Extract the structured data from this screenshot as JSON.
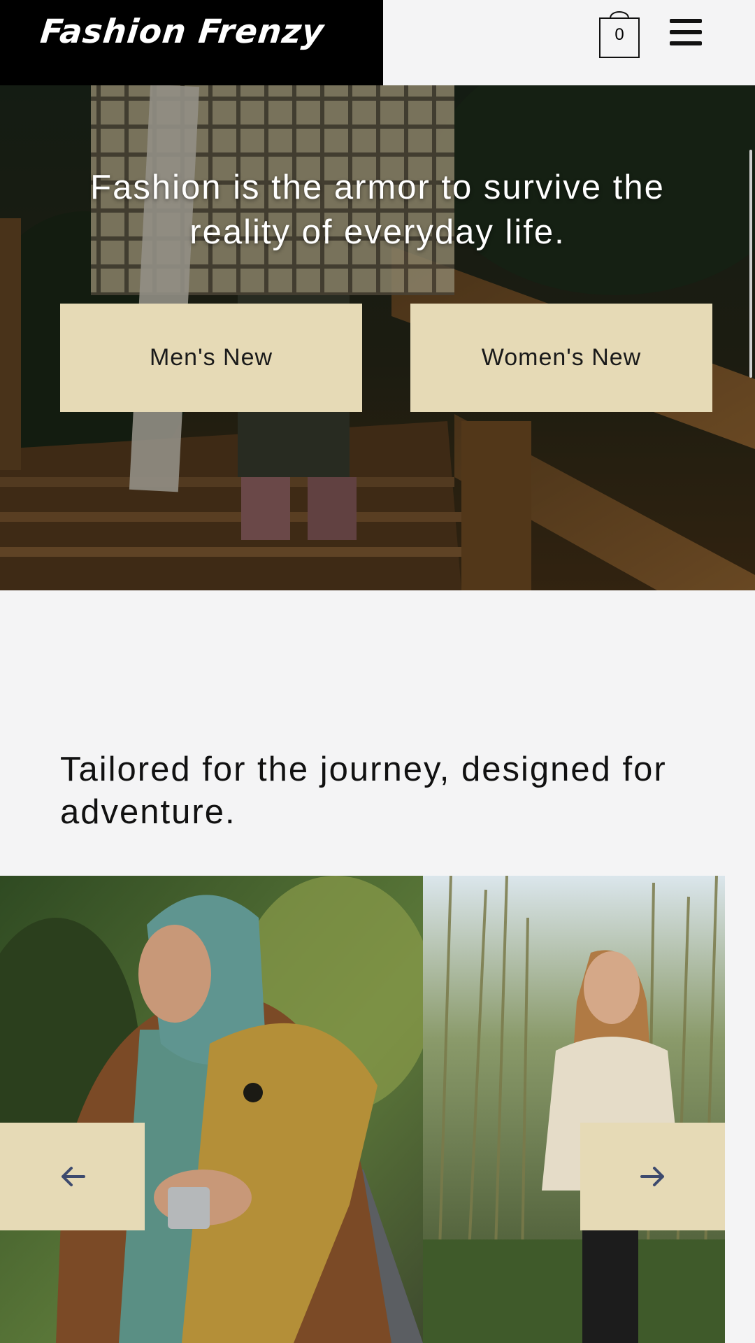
{
  "header": {
    "logo": "Fashion Frenzy",
    "cart_count": "0",
    "icons": {
      "cart": "shopping-bag-icon",
      "menu": "hamburger-menu-icon"
    }
  },
  "hero": {
    "quote": "Fashion is the armor to survive the reality of everyday life.",
    "buttons": {
      "mens": "Men's New",
      "womens": "Women's New"
    }
  },
  "section": {
    "title": "Tailored for the journey, designed for adventure."
  },
  "gallery": {
    "icons": {
      "prev": "arrow-left-icon",
      "next": "arrow-right-icon"
    }
  },
  "colors": {
    "accent": "#e6dab6",
    "header_bg": "#000000",
    "page_bg": "#f4f4f5",
    "arrow": "#3d4a6e"
  }
}
